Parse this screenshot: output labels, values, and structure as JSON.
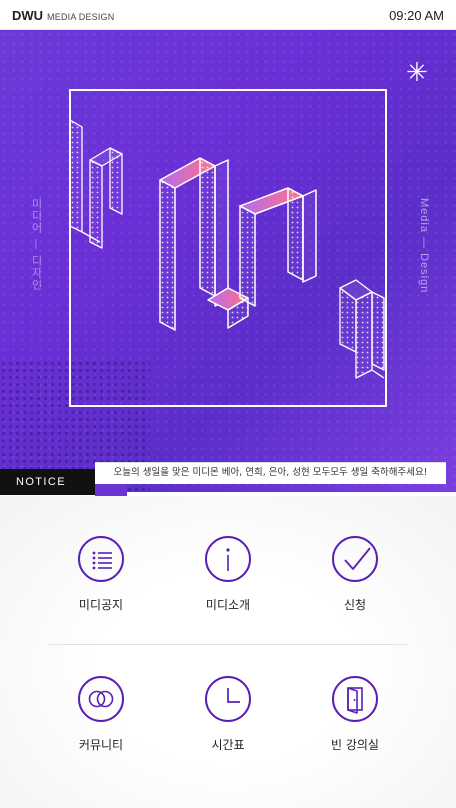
{
  "status_bar": {
    "brand": "DWU",
    "brand_sub": "MEDIA DESIGN",
    "time": "09:20 AM"
  },
  "hero": {
    "vertical_left": "미디어 — 디자인",
    "vertical_right": "Media — Design",
    "sparkle": "✳",
    "colors": {
      "background": "#6a34d6",
      "stroke": "#ffffff",
      "accent": "#ff6f8c"
    }
  },
  "notice": {
    "tab_label": "NOTICE",
    "message": "오늘의 생일을 맞은 미디몬 베아, 연희, 은아, 성현 모두모두 생일 축하해주세요!"
  },
  "menu": {
    "items": [
      {
        "label": "미디공지",
        "icon": "list-icon"
      },
      {
        "label": "미디소개",
        "icon": "info-icon"
      },
      {
        "label": "신청",
        "icon": "check-icon"
      },
      {
        "label": "커뮤니티",
        "icon": "rings-icon"
      },
      {
        "label": "시간표",
        "icon": "clock-icon"
      },
      {
        "label": "빈 강의실",
        "icon": "door-icon"
      }
    ],
    "colors": {
      "icon": "#5a1fb8"
    }
  }
}
